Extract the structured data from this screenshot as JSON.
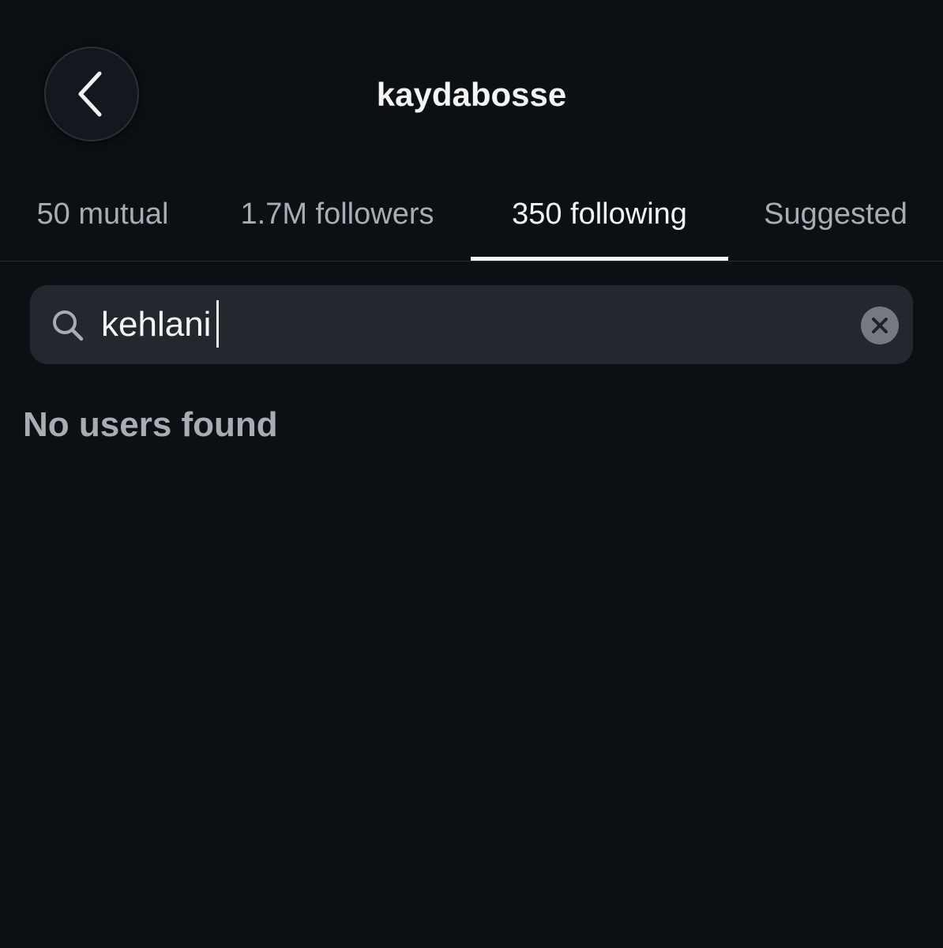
{
  "header": {
    "title": "kaydabosse",
    "back_icon": "chevron-left-icon"
  },
  "tabs": [
    {
      "label": "50 mutual",
      "active": false
    },
    {
      "label": "1.7M followers",
      "active": false
    },
    {
      "label": "350 following",
      "active": true
    },
    {
      "label": "Suggested",
      "active": false
    }
  ],
  "search": {
    "value": "kehlani",
    "icon": "search-icon",
    "clear_icon": "clear-icon"
  },
  "results": {
    "empty_message": "No users found"
  },
  "colors": {
    "background": "#0b1014",
    "search_bg": "#23282e",
    "text_primary": "#f5f5f5",
    "text_secondary": "#a8adb3",
    "clear_button": "#747a80"
  }
}
